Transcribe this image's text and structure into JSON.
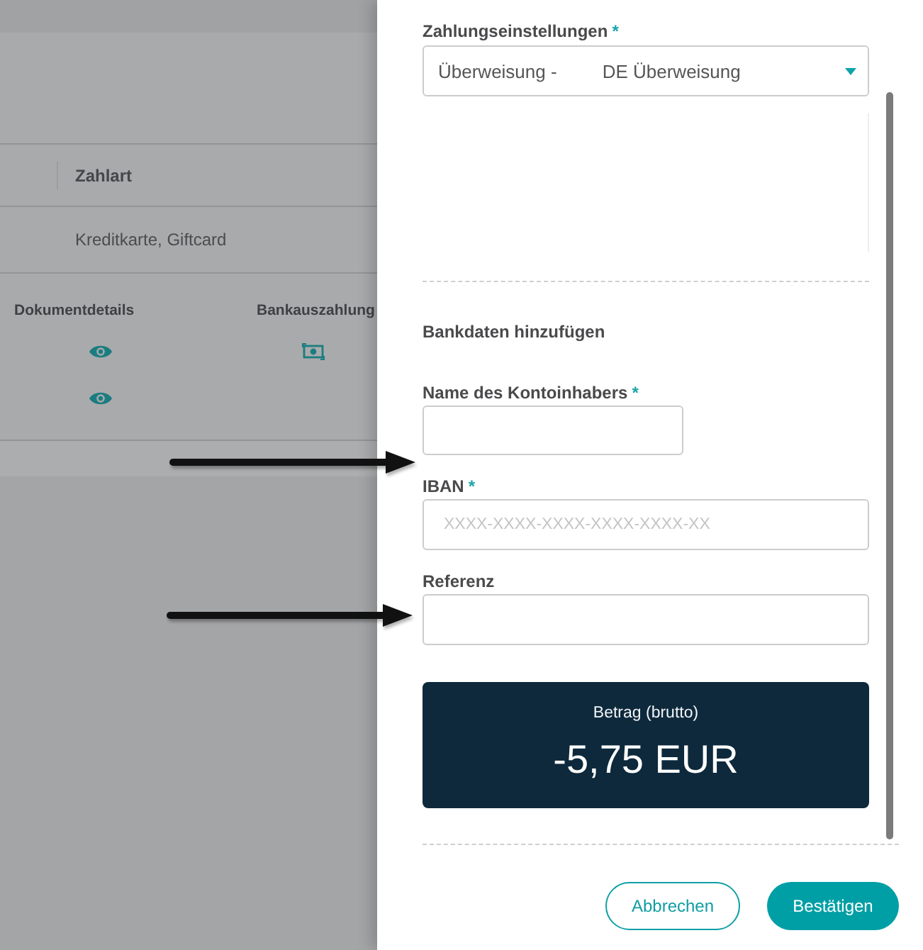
{
  "background_page": {
    "table": {
      "columns": [
        {
          "label": "Zahlart"
        }
      ],
      "rows": [
        {
          "zahlart": "Kreditkarte, Giftcard"
        }
      ]
    },
    "documents": {
      "columns": [
        "Dokumentdetails",
        "Bankauszahlung"
      ],
      "rows": [
        {
          "has_details": true,
          "has_payout": true
        },
        {
          "has_details": true,
          "has_payout": false
        }
      ]
    }
  },
  "drawer": {
    "payment_settings": {
      "label": "Zahlungseinstellungen",
      "required_mark": "*",
      "value_type": "Überweisung -",
      "value_name": "DE Überweisung"
    },
    "bank_section": {
      "title": "Bankdaten hinzufügen",
      "fields": [
        {
          "label": "Name des Kontoinhabers",
          "required_mark": "*",
          "kind": "short"
        },
        {
          "label": "IBAN",
          "required_mark": "*",
          "kind": "wide",
          "placeholder": "XXXX-XXXX-XXXX-XXXX-XXXX-XX"
        },
        {
          "label": "Referenz",
          "kind": "wide"
        }
      ]
    },
    "amount": {
      "label": "Betrag (brutto)",
      "value": "-5,75 EUR"
    },
    "buttons": [
      {
        "label": "Abbrechen",
        "kind": "secondary"
      },
      {
        "label": "Bestätigen",
        "kind": "primary"
      }
    ]
  }
}
